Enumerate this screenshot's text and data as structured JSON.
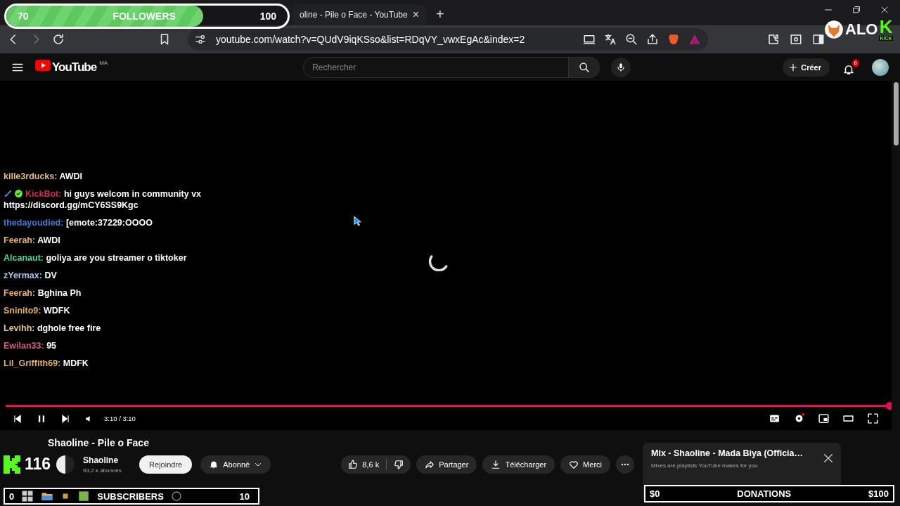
{
  "browser_tab": {
    "title": "oline - Pile o Face - YouTube",
    "close": "×",
    "new_tab": "+"
  },
  "address_bar": {
    "url": "youtube.com/watch?v=QUdV9iqKSso&list=RDqVY_vwxEgAc&index=2"
  },
  "youtube_header": {
    "logo": "YouTube",
    "region": "MA",
    "search_placeholder": "Rechercher",
    "create": "Créer",
    "notification_count": "6"
  },
  "chat": [
    {
      "kind": "user",
      "user": "kille3rducks:",
      "color": "#e2bd7a",
      "message": "AWDI"
    },
    {
      "kind": "bot",
      "user": "KickBot:",
      "color": "#d6264f",
      "message": "hi guys welcom in community vx https://discord.gg/mCY6SS9Kgc"
    },
    {
      "kind": "user",
      "user": "thedayoudied:",
      "color": "#3b7fd9",
      "message": "[emote:37229:OOOO"
    },
    {
      "kind": "user",
      "user": "Feerah:",
      "color": "#e9b463",
      "message": "AWDI"
    },
    {
      "kind": "user",
      "user": "Alcanaut:",
      "color": "#3fd6a8",
      "message": "goliya are you streamer o tiktoker"
    },
    {
      "kind": "user",
      "user": "zYermax:",
      "color": "#a9c4e8",
      "message": "DV"
    },
    {
      "kind": "user",
      "user": "Feerah:",
      "color": "#e9b463",
      "message": "Bghina Ph"
    },
    {
      "kind": "user",
      "user": "Sninito9:",
      "color": "#e3b04f",
      "message": "WDFK"
    },
    {
      "kind": "user",
      "user": "Levihh:",
      "color": "#e8c48a",
      "message": "dghole free fire"
    },
    {
      "kind": "user",
      "user": "Ewilan33:",
      "color": "#d85a86",
      "message": "95"
    },
    {
      "kind": "user",
      "user": "Lil_Griffith69:",
      "color": "#e0b55c",
      "message": "MDFK"
    }
  ],
  "player": {
    "progress": {
      "level": 1
    },
    "time": "3:10 / 3:10"
  },
  "video": {
    "title": "Shaoline - Pile o Face",
    "channel": "Shaoline",
    "subscribers": "93,2 k abonnés",
    "join": "Rejoindre",
    "subscribed": "Abonné",
    "likes": "8,6 k",
    "share": "Partager",
    "download": "Télécharger",
    "thanks": "Merci"
  },
  "mix": {
    "title": "Mix - Shaoline - Mada Biya (Officia…",
    "subtitle": "Mixes are playlists YouTube makes for you"
  },
  "overlays": {
    "followers": {
      "current": "70",
      "label": "FOLLOWERS",
      "goal": "100",
      "level": 0.7
    },
    "kick_count": "116",
    "subscribers": {
      "current": "0",
      "label": "SUBSCRIBERS",
      "goal": "10",
      "level": 0
    },
    "donations": {
      "current": "$0",
      "label": "DONATIONS",
      "goal": "$100",
      "level": 0
    },
    "logo": {
      "text": "ALO",
      "letter": "K",
      "sub": "KICK"
    }
  }
}
